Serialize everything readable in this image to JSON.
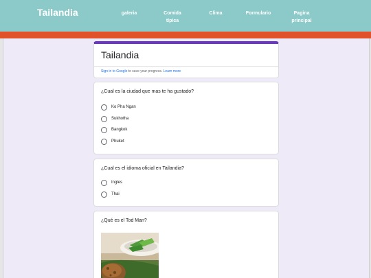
{
  "header": {
    "site_title": "Tailandia",
    "nav": [
      {
        "line1": "galeria",
        "line2": ""
      },
      {
        "line1": "Comida",
        "line2": "típica"
      },
      {
        "line1": "Clima",
        "line2": ""
      },
      {
        "line1": "Formulario",
        "line2": ""
      },
      {
        "line1": "Pagina",
        "line2": "principal"
      }
    ]
  },
  "colors": {
    "header_bg": "#8ccac9",
    "accent_bar": "#e0532a",
    "form_bg": "#efeaf8",
    "form_accent": "#673ab7",
    "link": "#1a73e8"
  },
  "form": {
    "title": "Tailandia",
    "signin_link": "Sign in to Google",
    "signin_text": " to save your progress. ",
    "learn_more": "Learn more"
  },
  "questions": [
    {
      "text": "¿Cual es la ciudad que mas te ha gustado?",
      "options": [
        "Ko Pha Ngan",
        "Sukhotha",
        "Bangkok",
        "Phuket"
      ]
    },
    {
      "text": "¿Cual es el idioma oficial en Tailandia?",
      "options": [
        "Ingles",
        "Thai"
      ]
    },
    {
      "text": "¿Qué es el Tod Man?",
      "image": "tod-man-food-photo"
    }
  ]
}
